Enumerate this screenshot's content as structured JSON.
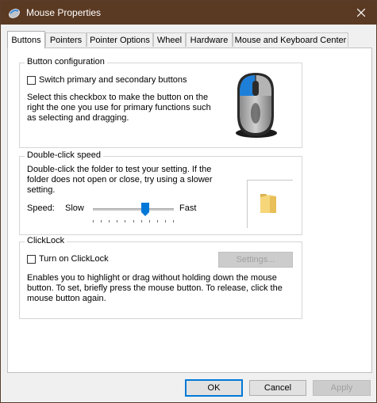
{
  "window": {
    "title": "Mouse Properties"
  },
  "tabs": [
    {
      "label": "Buttons",
      "active": true
    },
    {
      "label": "Pointers"
    },
    {
      "label": "Pointer Options"
    },
    {
      "label": "Wheel"
    },
    {
      "label": "Hardware"
    },
    {
      "label": "Mouse and Keyboard Center"
    }
  ],
  "button_config": {
    "heading": "Button configuration",
    "checkbox_label": "Switch primary and secondary buttons",
    "checked": false,
    "description_lines": [
      "Select this checkbox to make the button on the",
      "right the one you use for primary functions such",
      "as selecting and dragging."
    ]
  },
  "double_click": {
    "heading": "Double-click speed",
    "description_lines": [
      "Double-click the folder to test your setting. If the",
      "folder does not open or close, try using a slower",
      "setting."
    ],
    "speed_label": "Speed:",
    "slow_label": "Slow",
    "fast_label": "Fast",
    "speed_fraction": 0.66
  },
  "clicklock": {
    "heading": "ClickLock",
    "checkbox_label": "Turn on ClickLock",
    "checked": false,
    "settings_label": "Settings...",
    "description_lines": [
      "Enables you to highlight or drag without holding down the mouse",
      "button. To set, briefly press the mouse button. To release, click the",
      "mouse button again."
    ]
  },
  "footer": {
    "ok_label": "OK",
    "cancel_label": "Cancel",
    "apply_label": "Apply"
  },
  "colors": {
    "titlebar": "#5b3a23",
    "accent": "#0078d7"
  },
  "icons": {
    "window": "mouse-icon",
    "close": "close-icon",
    "folder": "folder-icon"
  }
}
